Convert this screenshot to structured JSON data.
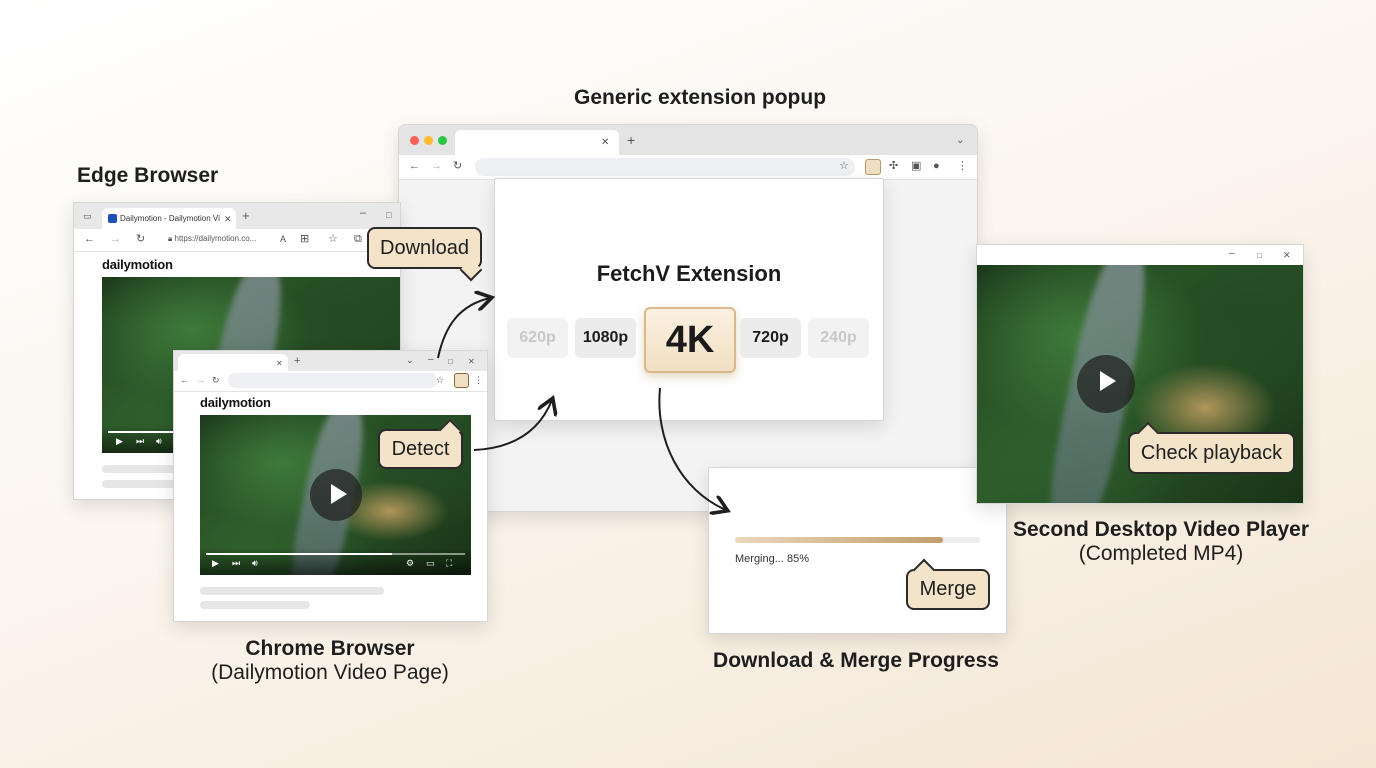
{
  "labels": {
    "popup_title": "Generic extension popup",
    "edge_title": "Edge Browser"
  },
  "edge": {
    "tab_title": "Dailymotion - Dailymotion Vi...",
    "address": "https://dailymotion.co...",
    "brand": "dailymotion"
  },
  "chrome": {
    "brand": "dailymotion",
    "caption_line1": "Chrome Browser",
    "caption_line2": "(Dailymotion Video Page)"
  },
  "extension": {
    "title": "FetchV Extension",
    "resolutions": [
      "620p",
      "1080p",
      "4K",
      "720p",
      "240p"
    ],
    "selected": "4K"
  },
  "progress": {
    "label": "Merging... 85%",
    "percent": 85,
    "caption": "Download & Merge Progress"
  },
  "player": {
    "caption_line1": "Second Desktop Video Player",
    "caption_line2": "(Completed MP4)"
  },
  "callouts": {
    "download": "Download",
    "detect": "Detect",
    "merge": "Merge",
    "check": "Check playback"
  },
  "colors": {
    "accent": "#f3e3c9",
    "progress_fill": "#c9a77a",
    "selected_border": "#d9b98a"
  }
}
